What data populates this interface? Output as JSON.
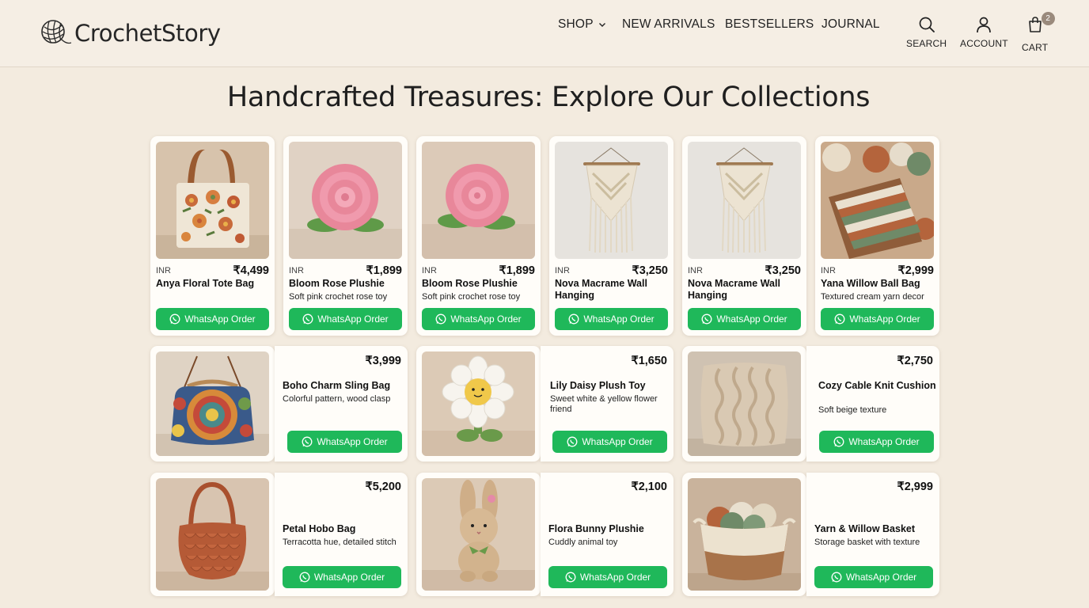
{
  "brand": {
    "name": "CrochetStory"
  },
  "nav": {
    "shop": "SHOP",
    "new_arrivals": "NEW ARRIVALS",
    "bestsellers": "BESTSELLERS",
    "journal": "JOURNAL"
  },
  "utilities": {
    "search": "SEARCH",
    "account": "ACCOUNT",
    "cart": "CART",
    "cart_count": "2"
  },
  "page_title": "Handcrafted Treasures: Explore Our Collections",
  "whatsapp_label": "WhatsApp Order",
  "colors": {
    "accent_green": "#1fb85a",
    "background": "#f3ebdf"
  },
  "products_row1": [
    {
      "currency": "INR",
      "price": "₹4,499",
      "name": "Anya Floral Tote Bag",
      "desc": ""
    },
    {
      "currency": "INR",
      "price": "₹1,899",
      "name": "Bloom Rose Plushie",
      "desc": "Soft pink crochet rose toy"
    },
    {
      "currency": "INR",
      "price": "₹1,899",
      "name": "Bloom Rose Plushie",
      "desc": "Soft pink crochet rose toy"
    },
    {
      "currency": "INR",
      "price": "₹3,250",
      "name": "Nova Macrame Wall Hanging",
      "desc": ""
    },
    {
      "currency": "INR",
      "price": "₹3,250",
      "name": "Nova Macrame Wall Hanging",
      "desc": ""
    },
    {
      "currency": "INR",
      "price": "₹2,999",
      "name": "Yana Willow Ball Bag",
      "desc": "Textured cream yarn decor"
    }
  ],
  "products_row2": [
    {
      "price": "₹3,999",
      "name": "Boho Charm Sling Bag",
      "desc": "Colorful pattern, wood clasp"
    },
    {
      "price": "₹1,650",
      "name": "Lily Daisy Plush Toy",
      "desc": "Sweet white & yellow flower friend"
    },
    {
      "price": "₹2,750",
      "name": "Cozy Cable Knit Cushion",
      "desc": "Soft beige texture"
    }
  ],
  "products_row3": [
    {
      "price": "₹5,200",
      "name": "Petal Hobo Bag",
      "desc": "Terracotta hue, detailed stitch"
    },
    {
      "price": "₹2,100",
      "name": "Flora Bunny Plushie",
      "desc": "Cuddly animal toy"
    },
    {
      "price": "₹2,999",
      "name": "Yarn & Willow Basket",
      "desc": "Storage basket with texture"
    }
  ]
}
